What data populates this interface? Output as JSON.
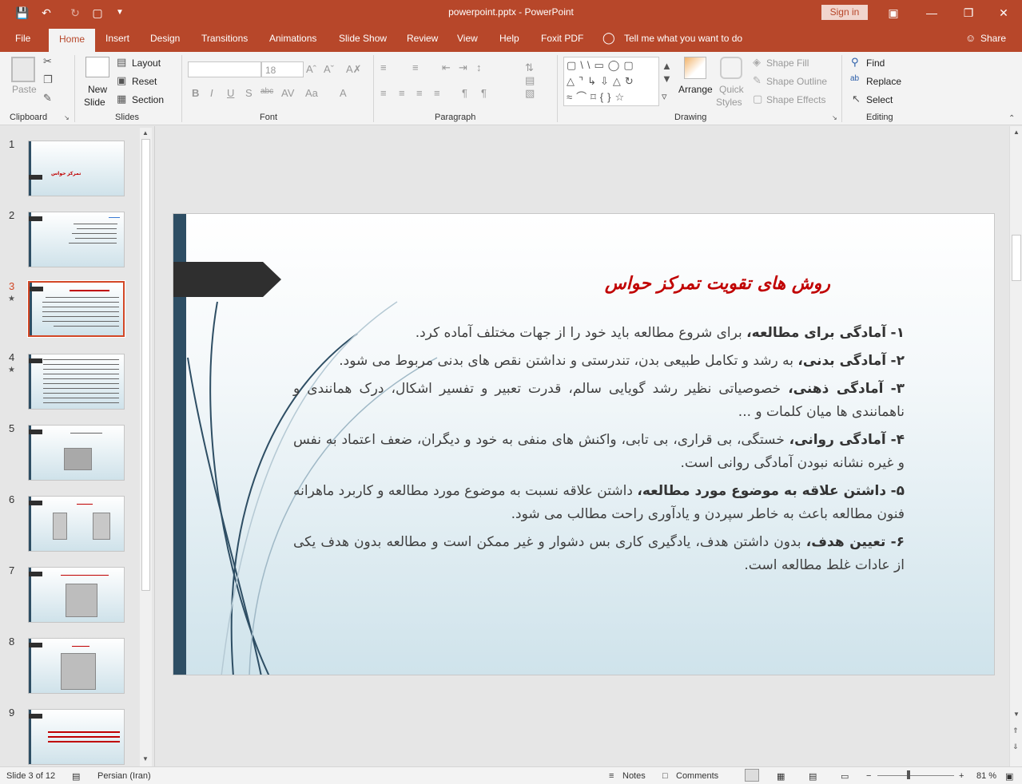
{
  "window": {
    "title": "powerpoint.pptx - PowerPoint",
    "signin": "Sign in"
  },
  "tabs": [
    "File",
    "Home",
    "Insert",
    "Design",
    "Transitions",
    "Animations",
    "Slide Show",
    "Review",
    "View",
    "Help",
    "Foxit PDF"
  ],
  "tellme": "Tell me what you want to do",
  "share": "Share",
  "ribbon": {
    "clipboard": {
      "label": "Clipboard",
      "paste": "Paste"
    },
    "slides": {
      "label": "Slides",
      "new_slide_1": "New",
      "new_slide_2": "Slide",
      "layout": "Layout",
      "reset": "Reset",
      "section": "Section"
    },
    "font": {
      "label": "Font",
      "size": "18"
    },
    "paragraph": {
      "label": "Paragraph"
    },
    "drawing": {
      "label": "Drawing",
      "arrange": "Arrange",
      "quick_1": "Quick",
      "quick_2": "Styles",
      "shape_fill": "Shape Fill",
      "shape_outline": "Shape Outline",
      "shape_effects": "Shape Effects"
    },
    "editing": {
      "label": "Editing",
      "find": "Find",
      "replace": "Replace",
      "select": "Select"
    }
  },
  "thumbnails": [
    "1",
    "2",
    "3",
    "4",
    "5",
    "6",
    "7",
    "8",
    "9"
  ],
  "selected_slide": 3,
  "slide": {
    "title": "روش های تقویت تمرکز حواس",
    "items": [
      {
        "num": "۱-",
        "head": "آمادگی برای مطالعه،",
        "text": "برای شروع مطالعه باید خود را از جهات مختلف آماده کرد."
      },
      {
        "num": "۲-",
        "head": "آمادگی بدنی،",
        "text": "به رشد و تکامل طبیعی بدن، تندرستی و نداشتن نقص های بدنی مربوط می شود."
      },
      {
        "num": "۳-",
        "head": "آمادگی ذهنی،",
        "text": "خصوصیاتی نظیر رشد گویایی سالم، قدرت تعبیر و تفسیر اشکال، درک همانندی و ناهمانندی ها میان کلمات و ..."
      },
      {
        "num": "۴-",
        "head": "آمادگی روانی،",
        "text": "خستگی، بی قراری، بی تابی، واکنش های منفی به خود و دیگران، ضعف اعتماد به نفس و غیره نشانه نبودن آمادگی روانی است."
      },
      {
        "num": "۵-",
        "head": "داشتن علاقه به موضوع مورد مطالعه،",
        "text": "داشتن علاقه نسبت به موضوع مورد مطالعه و کاربرد ماهرانه فنون مطالعه باعث به خاطر سپردن و یادآوری راحت مطالب می شود."
      },
      {
        "num": "۶-",
        "head": "تعیین هدف،",
        "text": "بدون داشتن هدف، یادگیری کاری بس دشوار و غیر ممکن است و مطالعه بدون هدف یکی از عادات غلط مطالعه است."
      }
    ]
  },
  "status": {
    "slide_info": "Slide 3 of 12",
    "language": "Persian (Iran)",
    "notes": "Notes",
    "comments": "Comments",
    "zoom": "81 %"
  }
}
